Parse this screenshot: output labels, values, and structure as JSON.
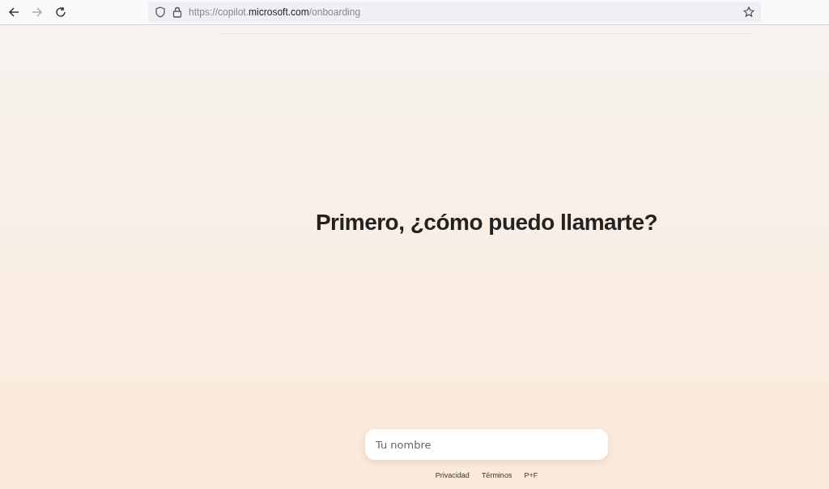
{
  "browser": {
    "nav_buttons": [
      {
        "kind": "back",
        "disabled": false
      },
      {
        "kind": "forward",
        "disabled": true
      },
      {
        "kind": "reload",
        "disabled": false
      }
    ],
    "address": {
      "prefix": "https://copilot.",
      "domain": "microsoft.com",
      "path": "/onboarding"
    }
  },
  "page": {
    "heading": "Primero, ¿cómo puedo llamarte?",
    "name_field": {
      "placeholder": "Tu nombre"
    },
    "footer_links": [
      "Privacidad",
      "Términos",
      "P+F"
    ]
  }
}
